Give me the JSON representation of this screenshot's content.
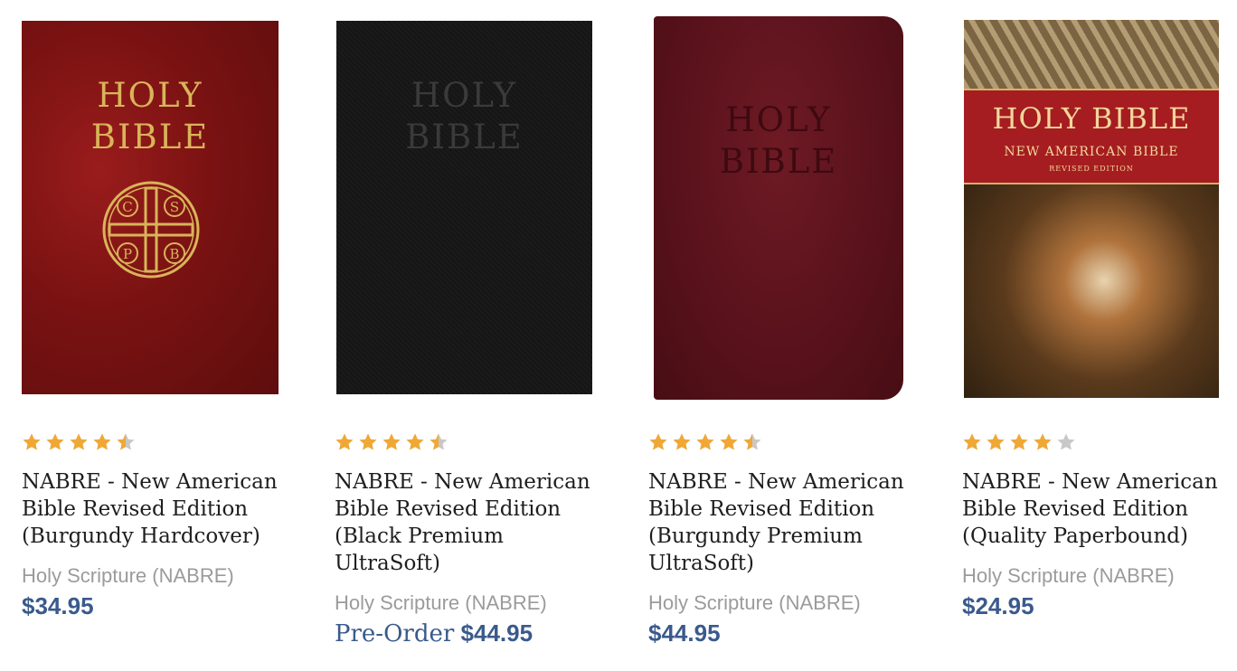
{
  "products": [
    {
      "cover_line1": "HOLY",
      "cover_line2": "BIBLE",
      "emblem_letters": [
        "C",
        "S",
        "P",
        "B"
      ],
      "rating": 4.5,
      "title": "NABRE - New American Bible Revised Edition (Burgundy Hardcover)",
      "publisher": "Holy Scripture (NABRE)",
      "price": "$34.95",
      "preorder_label": ""
    },
    {
      "cover_line1": "HOLY",
      "cover_line2": "BIBLE",
      "rating": 4.5,
      "title": "NABRE - New American Bible Revised Edition (Black Premium UltraSoft)",
      "publisher": "Holy Scripture (NABRE)",
      "price": "$44.95",
      "preorder_label": "Pre-Order"
    },
    {
      "cover_line1": "HOLY",
      "cover_line2": "BIBLE",
      "rating": 4.5,
      "title": "NABRE - New American Bible Revised Edition (Burgundy Premium UltraSoft)",
      "publisher": "Holy Scripture (NABRE)",
      "price": "$44.95",
      "preorder_label": ""
    },
    {
      "cover_line1": "HOLY BIBLE",
      "cover_line2": "NEW AMERICAN BIBLE",
      "cover_line3": "REVISED EDITION",
      "rating": 4.0,
      "title": "NABRE - New American Bible Revised Edition (Quality Paperbound)",
      "publisher": "Holy Scripture (NABRE)",
      "price": "$24.95",
      "preorder_label": ""
    }
  ],
  "colors": {
    "star": "#f0a835",
    "star_empty": "#c8c8c8",
    "price": "#3a5a8c",
    "publisher": "#9b9b9b"
  }
}
